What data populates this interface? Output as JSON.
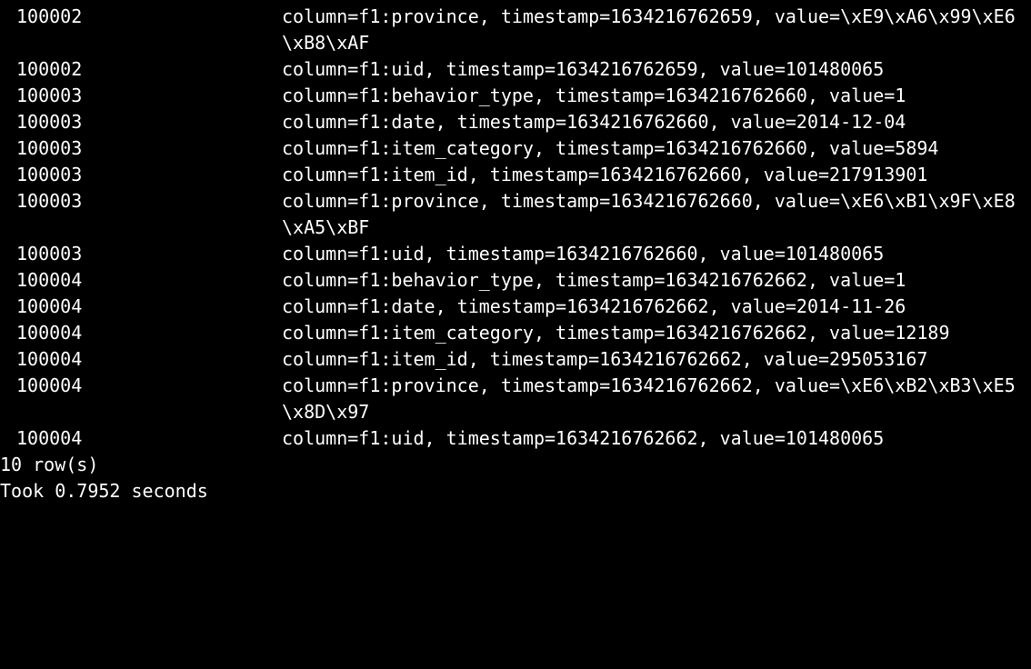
{
  "rows": [
    {
      "key": "100002",
      "column": "f1:province",
      "timestamp": "1634216762659",
      "value": "\\xE9\\xA6\\x99\\xE6\\xB8\\xAF"
    },
    {
      "key": "100002",
      "column": "f1:uid",
      "timestamp": "1634216762659",
      "value": "101480065"
    },
    {
      "key": "100003",
      "column": "f1:behavior_type",
      "timestamp": "1634216762660",
      "value": "1"
    },
    {
      "key": "100003",
      "column": "f1:date",
      "timestamp": "1634216762660",
      "value": "2014-12-04"
    },
    {
      "key": "100003",
      "column": "f1:item_category",
      "timestamp": "1634216762660",
      "value": "5894"
    },
    {
      "key": "100003",
      "column": "f1:item_id",
      "timestamp": "1634216762660",
      "value": "217913901"
    },
    {
      "key": "100003",
      "column": "f1:province",
      "timestamp": "1634216762660",
      "value": "\\xE6\\xB1\\x9F\\xE8\\xA5\\xBF"
    },
    {
      "key": "100003",
      "column": "f1:uid",
      "timestamp": "1634216762660",
      "value": "101480065"
    },
    {
      "key": "100004",
      "column": "f1:behavior_type",
      "timestamp": "1634216762662",
      "value": "1"
    },
    {
      "key": "100004",
      "column": "f1:date",
      "timestamp": "1634216762662",
      "value": "2014-11-26"
    },
    {
      "key": "100004",
      "column": "f1:item_category",
      "timestamp": "1634216762662",
      "value": "12189"
    },
    {
      "key": "100004",
      "column": "f1:item_id",
      "timestamp": "1634216762662",
      "value": "295053167"
    },
    {
      "key": "100004",
      "column": "f1:province",
      "timestamp": "1634216762662",
      "value": "\\xE6\\xB2\\xB3\\xE5\\x8D\\x97"
    },
    {
      "key": "100004",
      "column": "f1:uid",
      "timestamp": "1634216762662",
      "value": "101480065"
    }
  ],
  "footer": {
    "row_count": "10 row(s)",
    "took": "Took 0.7952 seconds"
  }
}
